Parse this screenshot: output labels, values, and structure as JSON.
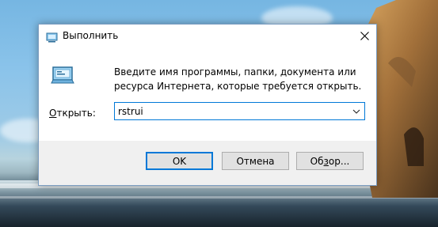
{
  "dialog": {
    "title": "Выполнить",
    "description": "Введите имя программы, папки, документа или ресурса Интернета, которые требуется открыть.",
    "open_label_accel": "О",
    "open_label_rest": "ткрыть:",
    "command_value": "rstrui",
    "ok_label": "OK",
    "cancel_label": "Отмена",
    "browse_label_start": "Об",
    "browse_label_accel": "з",
    "browse_label_end": "ор...",
    "icons": {
      "title": "run-icon",
      "main": "run-icon",
      "close": "close-icon",
      "dropdown": "chevron-down-icon"
    },
    "accent_color": "#0078d7"
  }
}
